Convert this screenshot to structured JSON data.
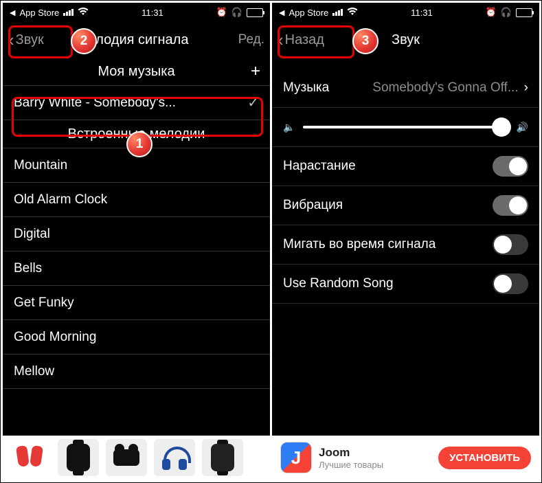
{
  "status": {
    "back_app": "App Store",
    "time": "11:31"
  },
  "leftScreen": {
    "back_label": "Звук",
    "title": "...лодия сигнала",
    "edit": "Ред.",
    "my_music_header": "Моя музыка",
    "selected_track": "Barry White -  Somebody's...",
    "builtin_header": "Встроенные мелодии",
    "builtin": [
      "Mountain",
      "Old Alarm Clock",
      "Digital",
      "Bells",
      "Get Funky",
      "Good Morning",
      "Mellow"
    ]
  },
  "rightScreen": {
    "back_label": "Назад",
    "title": "Звук",
    "music_label": "Музыка",
    "music_value": "Somebody's Gonna Off...",
    "rows": {
      "fade_in": "Нарастание",
      "vibration": "Вибрация",
      "flash": "Мигать во время сигнала",
      "random": "Use Random Song"
    },
    "toggles": {
      "fade_in": true,
      "vibration": true,
      "flash": false,
      "random": false
    }
  },
  "bannerRight": {
    "name": "Joom",
    "subtitle": "Лучшие товары",
    "install": "УСТАНОВИТЬ"
  },
  "badges": {
    "b1": "1",
    "b2": "2",
    "b3": "3"
  }
}
